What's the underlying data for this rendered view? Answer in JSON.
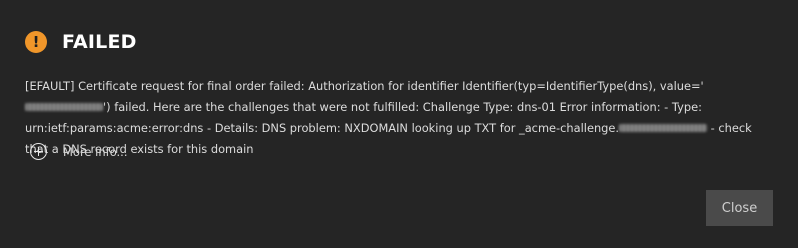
{
  "dialog": {
    "title": "FAILED",
    "status_icon": "warning-icon",
    "status_icon_glyph": "!",
    "accent_color": "#f0962a",
    "message": {
      "part1": "[EFAULT] Certificate request for final order failed: Authorization for identifier Identifier(typ=IdentifierType(dns), value='",
      "part2": "') failed. Here are the challenges that were not fulfilled: Challenge Type: dns-01 Error information: - Type: urn:ietf:params:acme:error:dns - Details: DNS problem: NXDOMAIN looking up TXT for _acme-challenge.",
      "part3": " - check that a DNS record exists for this domain"
    },
    "more_info_label": "More info...",
    "more_info_icon": "plus-circle-icon",
    "close_label": "Close"
  }
}
